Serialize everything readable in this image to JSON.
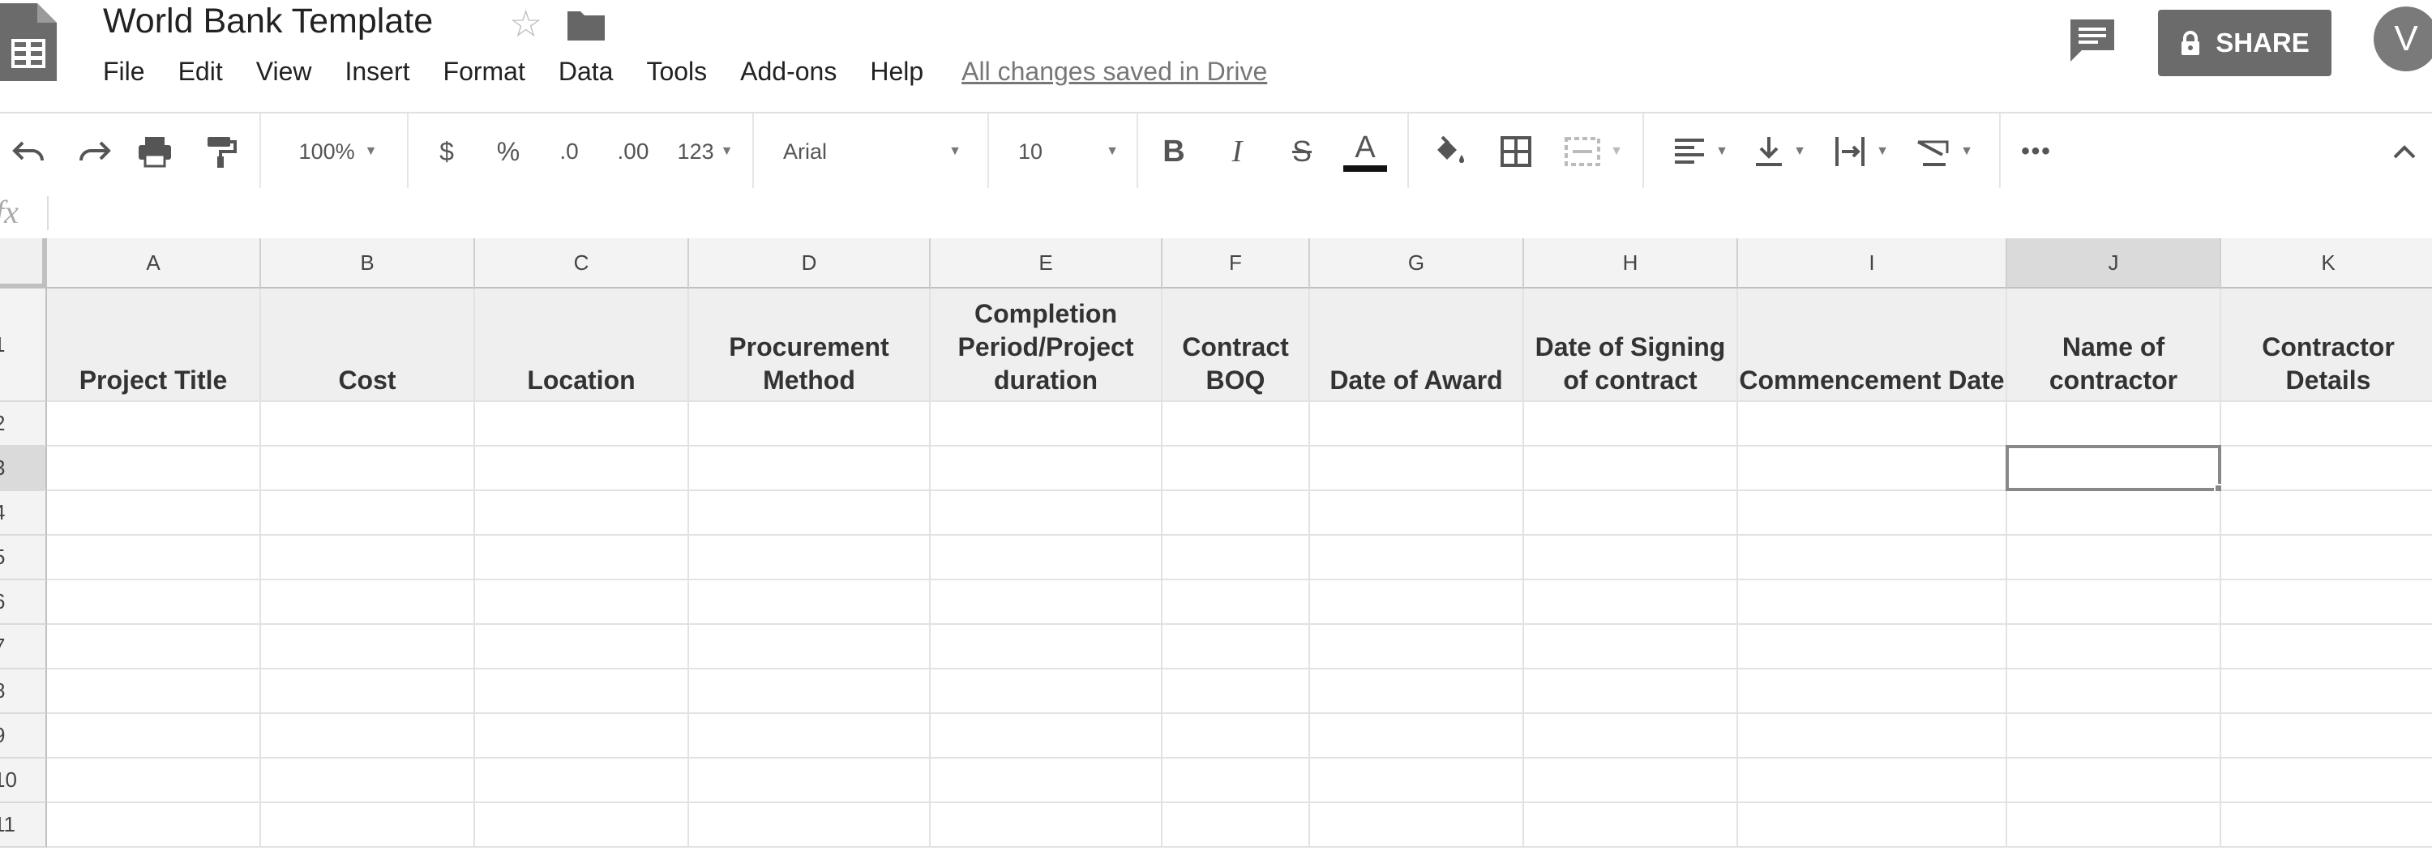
{
  "app": {
    "doc_title": "World Bank Template",
    "saved_status": "All changes saved in Drive",
    "share_label": "SHARE",
    "avatar_initial": "V",
    "icons": [
      "sheets-logo-icon",
      "star-icon",
      "folder-icon",
      "comment-icon",
      "lock-icon"
    ]
  },
  "menu": [
    "File",
    "Edit",
    "View",
    "Insert",
    "Format",
    "Data",
    "Tools",
    "Add-ons",
    "Help"
  ],
  "toolbar": {
    "zoom": "100%",
    "currency": "$",
    "percent": "%",
    "decrease_decimal": ".0",
    "increase_decimal": ".00",
    "more_formats": "123",
    "font": "Arial",
    "font_size": "10",
    "text_color": "#111111"
  },
  "formula_bar": {
    "label": "fx",
    "value": ""
  },
  "grid": {
    "columns": [
      "A",
      "B",
      "C",
      "D",
      "E",
      "F",
      "G",
      "H",
      "I",
      "J",
      "K"
    ],
    "rows": [
      "1",
      "2",
      "3",
      "4",
      "5",
      "6",
      "7",
      "8",
      "9",
      "10",
      "11"
    ],
    "header_row": [
      "Project Title",
      "Cost",
      "Location",
      "Procurement Method",
      "Completion Period/Project duration",
      "Contract BOQ",
      "Date of Award",
      "Date of Signing of contract",
      "Commencement Date",
      "Name of contractor",
      "Contractor Details"
    ],
    "selected_cell": "J3"
  }
}
